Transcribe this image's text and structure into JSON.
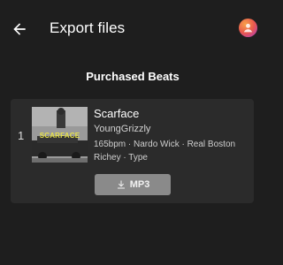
{
  "header": {
    "title": "Export files",
    "back_icon": "arrow-left-icon",
    "avatar_icon": "user-avatar-icon"
  },
  "section": {
    "heading": "Purchased Beats"
  },
  "beats": [
    {
      "rank": "1",
      "cover_text": "SCARFACE",
      "title": "Scarface",
      "producer": "YoungGrizzly",
      "tags": "165bpm · Nardo Wick · Real Boston Richey · Type",
      "format_button": "MP3",
      "format_icon": "download-icon"
    }
  ],
  "colors": {
    "background": "#1e1e1e",
    "card": "#2b2b2b",
    "button": "#8a8a8a",
    "cover_accent": "#e6e14a"
  }
}
